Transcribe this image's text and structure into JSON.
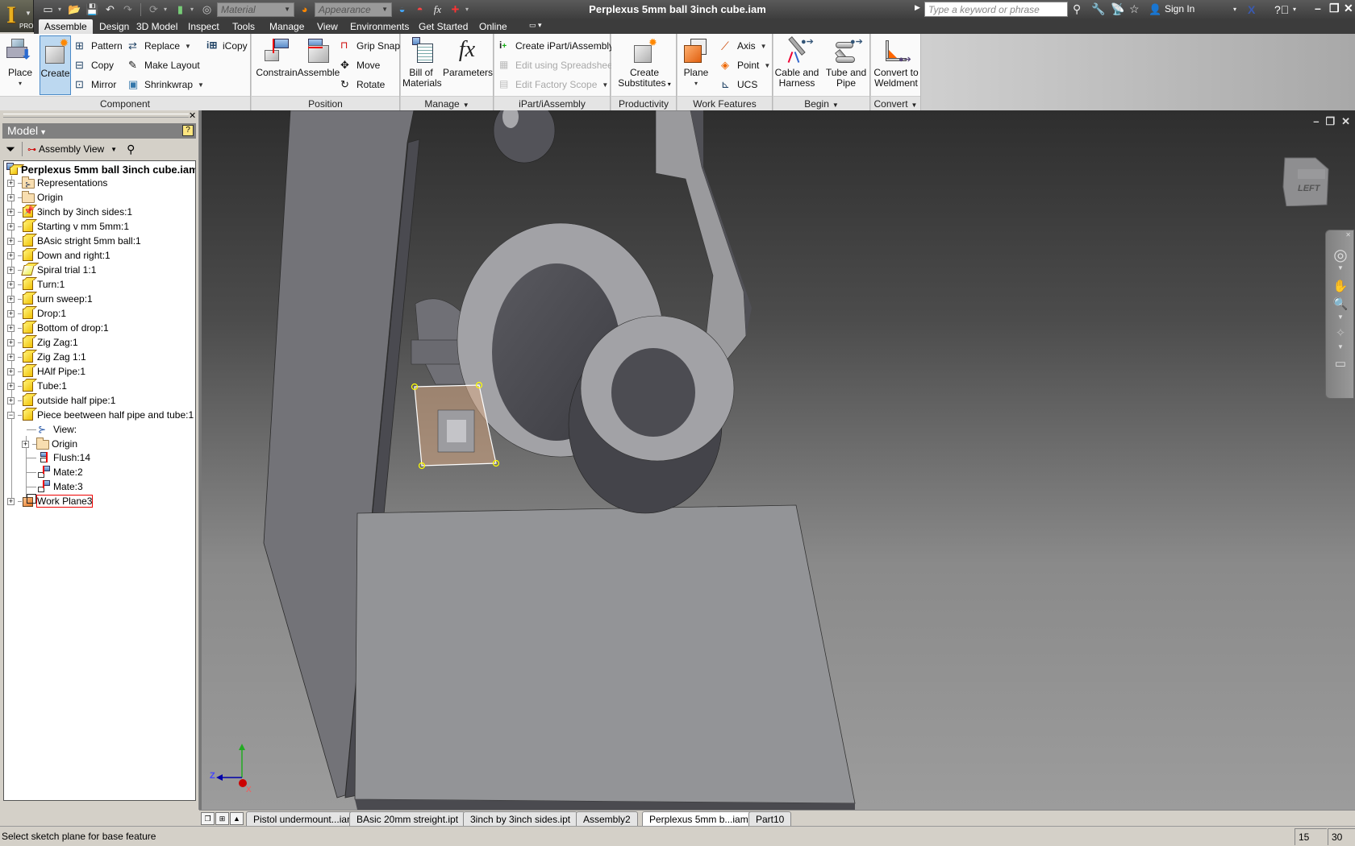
{
  "titlebar": {
    "document_title": "Perplexus 5mm ball 3inch cube.iam",
    "app_badge": "PRO",
    "material_combo": "Material",
    "appearance_combo": "Appearance",
    "search_placeholder": "Type a keyword or phrase",
    "sign_in": "Sign In"
  },
  "ribbon_tabs": [
    "Assemble",
    "Design",
    "3D Model",
    "Inspect",
    "Tools",
    "Manage",
    "View",
    "Environments",
    "Get Started",
    "Online"
  ],
  "active_ribbon_tab": "Assemble",
  "ribbon": {
    "component": {
      "title": "Component",
      "place": "Place",
      "create": "Create",
      "pattern": "Pattern",
      "copy": "Copy",
      "mirror": "Mirror",
      "replace": "Replace",
      "make_layout": "Make Layout",
      "shrinkwrap": "Shrinkwrap",
      "icopy": "iCopy"
    },
    "position": {
      "title": "Position",
      "constrain": "Constrain",
      "assemble": "Assemble",
      "grip_snap": "Grip Snap",
      "move": "Move",
      "rotate": "Rotate"
    },
    "manage": {
      "title": "Manage",
      "bom_line1": "Bill of",
      "bom_line2": "Materials",
      "parameters": "Parameters"
    },
    "ipart": {
      "title": "iPart/iAssembly",
      "create": "Create iPart/iAssembly",
      "edit_spreadsheet": "Edit using Spreadsheet",
      "edit_factory": "Edit Factory Scope"
    },
    "productivity": {
      "title": "Productivity",
      "line1": "Create",
      "line2": "Substitutes"
    },
    "work_features": {
      "title": "Work Features",
      "plane": "Plane",
      "axis": "Axis",
      "point": "Point",
      "ucs": "UCS"
    },
    "begin": {
      "title": "Begin",
      "cable_line1": "Cable and",
      "cable_line2": "Harness",
      "tube_line1": "Tube and",
      "tube_line2": "Pipe"
    },
    "convert": {
      "title": "Convert",
      "line1": "Convert to",
      "line2": "Weldment"
    }
  },
  "browser": {
    "header": "Model",
    "view_selector": "Assembly View",
    "root": "Perplexus 5mm ball 3inch cube.iam",
    "items": [
      {
        "label": "Representations",
        "icon": "representations"
      },
      {
        "label": "Origin",
        "icon": "folder"
      },
      {
        "label": "3inch by 3inch sides:1",
        "icon": "grounded-part"
      },
      {
        "label": "Starting v mm 5mm:1",
        "icon": "part"
      },
      {
        "label": "BAsic stright 5mm ball:1",
        "icon": "part"
      },
      {
        "label": "Down and right:1",
        "icon": "part"
      },
      {
        "label": "Spiral trial 1:1",
        "icon": "surface-part"
      },
      {
        "label": "Turn:1",
        "icon": "part"
      },
      {
        "label": "turn sweep:1",
        "icon": "part"
      },
      {
        "label": "Drop:1",
        "icon": "part"
      },
      {
        "label": "Bottom of drop:1",
        "icon": "part"
      },
      {
        "label": "Zig Zag:1",
        "icon": "part"
      },
      {
        "label": "Zig Zag 1:1",
        "icon": "part"
      },
      {
        "label": "HAlf Pipe:1",
        "icon": "part"
      },
      {
        "label": "Tube:1",
        "icon": "part"
      },
      {
        "label": "outside half pipe:1",
        "icon": "part"
      },
      {
        "label": "Piece beetween half pipe and tube:1",
        "icon": "part"
      }
    ],
    "children": [
      {
        "label": "View:",
        "icon": "view"
      },
      {
        "label": "Origin",
        "icon": "folder"
      },
      {
        "label": "Flush:14",
        "icon": "flush"
      },
      {
        "label": "Mate:2",
        "icon": "mate"
      },
      {
        "label": "Mate:3",
        "icon": "mate"
      }
    ],
    "last_item": {
      "label": "Work Plane3",
      "icon": "work-plane"
    }
  },
  "viewport": {
    "viewcube_face": "LEFT",
    "triad": {
      "x": "X",
      "y": "Y",
      "z": "Z"
    }
  },
  "document_tabs": [
    {
      "label": "Pistol undermount...iam",
      "active": false
    },
    {
      "label": "BAsic 20mm streight.ipt",
      "active": false
    },
    {
      "label": "3inch by 3inch sides.ipt",
      "active": false
    },
    {
      "label": "Assembly2",
      "active": false
    },
    {
      "label": "Perplexus 5mm b...iam",
      "active": true
    },
    {
      "label": "Part10",
      "active": false
    }
  ],
  "statusbar": {
    "message": "Select sketch plane for base feature",
    "count1": "15",
    "count2": "30"
  }
}
